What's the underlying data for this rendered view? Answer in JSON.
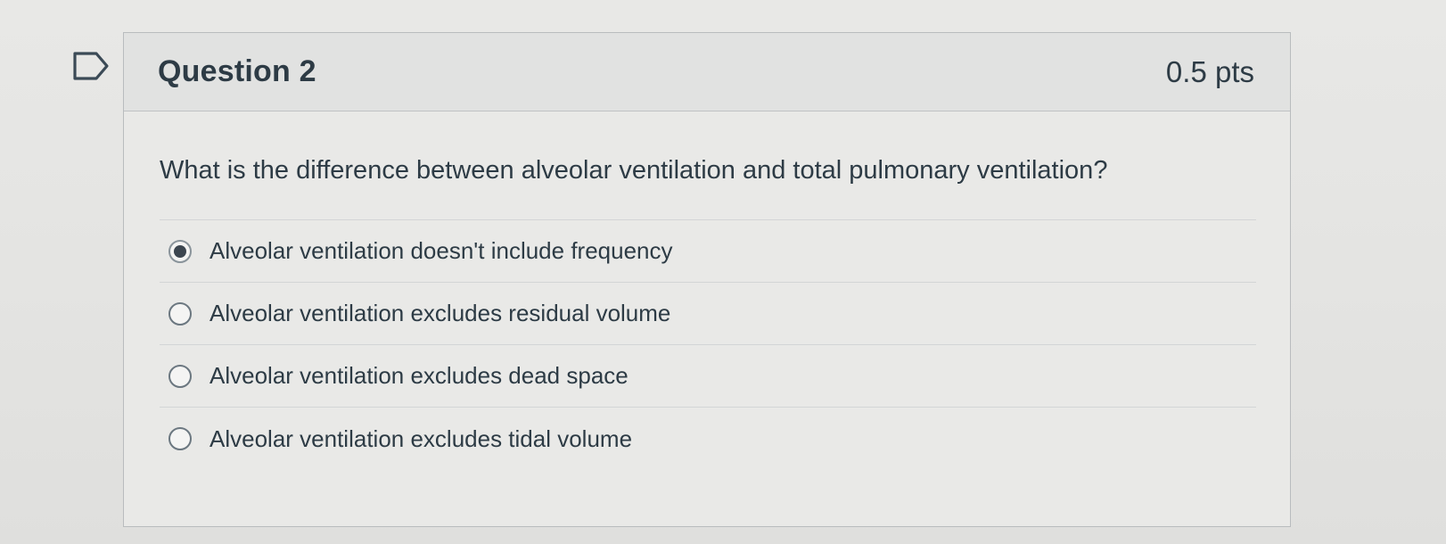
{
  "question": {
    "title": "Question 2",
    "points": "0.5 pts",
    "text": "What is the difference between alveolar ventilation and total pulmonary ventilation?",
    "flag_icon": "flag-outline-icon",
    "answers": [
      {
        "label": "Alveolar ventilation doesn't include frequency",
        "selected": true
      },
      {
        "label": "Alveolar ventilation excludes residual volume",
        "selected": false
      },
      {
        "label": "Alveolar ventilation excludes dead space",
        "selected": false
      },
      {
        "label": "Alveolar ventilation excludes tidal volume",
        "selected": false
      }
    ]
  },
  "colors": {
    "text": "#2d3b45",
    "border": "#b9bcbe",
    "header_bg": "#e1e2e1"
  }
}
